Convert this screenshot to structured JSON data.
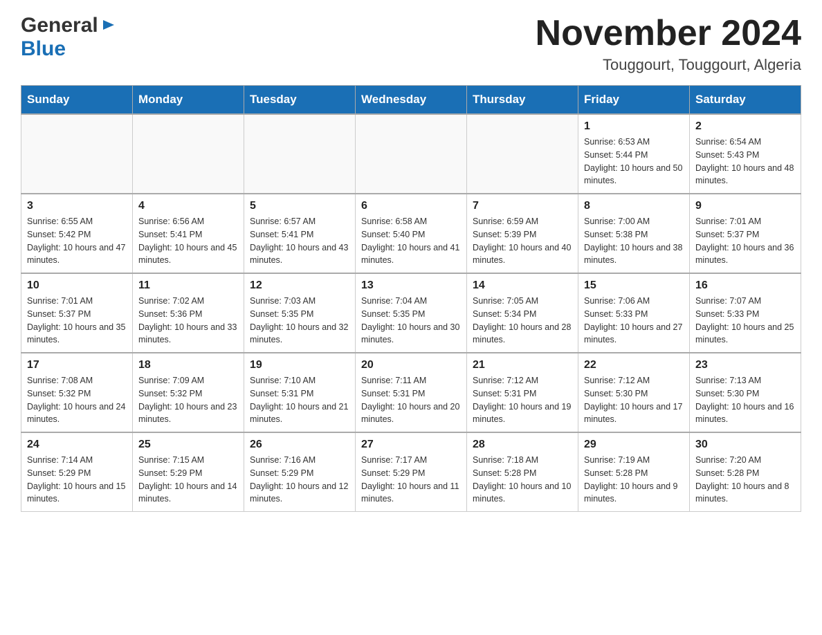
{
  "header": {
    "logo_general": "General",
    "logo_blue": "Blue",
    "month_title": "November 2024",
    "location": "Touggourt, Touggourt, Algeria"
  },
  "days_of_week": [
    "Sunday",
    "Monday",
    "Tuesday",
    "Wednesday",
    "Thursday",
    "Friday",
    "Saturday"
  ],
  "weeks": [
    [
      {
        "day": "",
        "sunrise": "",
        "sunset": "",
        "daylight": ""
      },
      {
        "day": "",
        "sunrise": "",
        "sunset": "",
        "daylight": ""
      },
      {
        "day": "",
        "sunrise": "",
        "sunset": "",
        "daylight": ""
      },
      {
        "day": "",
        "sunrise": "",
        "sunset": "",
        "daylight": ""
      },
      {
        "day": "",
        "sunrise": "",
        "sunset": "",
        "daylight": ""
      },
      {
        "day": "1",
        "sunrise": "Sunrise: 6:53 AM",
        "sunset": "Sunset: 5:44 PM",
        "daylight": "Daylight: 10 hours and 50 minutes."
      },
      {
        "day": "2",
        "sunrise": "Sunrise: 6:54 AM",
        "sunset": "Sunset: 5:43 PM",
        "daylight": "Daylight: 10 hours and 48 minutes."
      }
    ],
    [
      {
        "day": "3",
        "sunrise": "Sunrise: 6:55 AM",
        "sunset": "Sunset: 5:42 PM",
        "daylight": "Daylight: 10 hours and 47 minutes."
      },
      {
        "day": "4",
        "sunrise": "Sunrise: 6:56 AM",
        "sunset": "Sunset: 5:41 PM",
        "daylight": "Daylight: 10 hours and 45 minutes."
      },
      {
        "day": "5",
        "sunrise": "Sunrise: 6:57 AM",
        "sunset": "Sunset: 5:41 PM",
        "daylight": "Daylight: 10 hours and 43 minutes."
      },
      {
        "day": "6",
        "sunrise": "Sunrise: 6:58 AM",
        "sunset": "Sunset: 5:40 PM",
        "daylight": "Daylight: 10 hours and 41 minutes."
      },
      {
        "day": "7",
        "sunrise": "Sunrise: 6:59 AM",
        "sunset": "Sunset: 5:39 PM",
        "daylight": "Daylight: 10 hours and 40 minutes."
      },
      {
        "day": "8",
        "sunrise": "Sunrise: 7:00 AM",
        "sunset": "Sunset: 5:38 PM",
        "daylight": "Daylight: 10 hours and 38 minutes."
      },
      {
        "day": "9",
        "sunrise": "Sunrise: 7:01 AM",
        "sunset": "Sunset: 5:37 PM",
        "daylight": "Daylight: 10 hours and 36 minutes."
      }
    ],
    [
      {
        "day": "10",
        "sunrise": "Sunrise: 7:01 AM",
        "sunset": "Sunset: 5:37 PM",
        "daylight": "Daylight: 10 hours and 35 minutes."
      },
      {
        "day": "11",
        "sunrise": "Sunrise: 7:02 AM",
        "sunset": "Sunset: 5:36 PM",
        "daylight": "Daylight: 10 hours and 33 minutes."
      },
      {
        "day": "12",
        "sunrise": "Sunrise: 7:03 AM",
        "sunset": "Sunset: 5:35 PM",
        "daylight": "Daylight: 10 hours and 32 minutes."
      },
      {
        "day": "13",
        "sunrise": "Sunrise: 7:04 AM",
        "sunset": "Sunset: 5:35 PM",
        "daylight": "Daylight: 10 hours and 30 minutes."
      },
      {
        "day": "14",
        "sunrise": "Sunrise: 7:05 AM",
        "sunset": "Sunset: 5:34 PM",
        "daylight": "Daylight: 10 hours and 28 minutes."
      },
      {
        "day": "15",
        "sunrise": "Sunrise: 7:06 AM",
        "sunset": "Sunset: 5:33 PM",
        "daylight": "Daylight: 10 hours and 27 minutes."
      },
      {
        "day": "16",
        "sunrise": "Sunrise: 7:07 AM",
        "sunset": "Sunset: 5:33 PM",
        "daylight": "Daylight: 10 hours and 25 minutes."
      }
    ],
    [
      {
        "day": "17",
        "sunrise": "Sunrise: 7:08 AM",
        "sunset": "Sunset: 5:32 PM",
        "daylight": "Daylight: 10 hours and 24 minutes."
      },
      {
        "day": "18",
        "sunrise": "Sunrise: 7:09 AM",
        "sunset": "Sunset: 5:32 PM",
        "daylight": "Daylight: 10 hours and 23 minutes."
      },
      {
        "day": "19",
        "sunrise": "Sunrise: 7:10 AM",
        "sunset": "Sunset: 5:31 PM",
        "daylight": "Daylight: 10 hours and 21 minutes."
      },
      {
        "day": "20",
        "sunrise": "Sunrise: 7:11 AM",
        "sunset": "Sunset: 5:31 PM",
        "daylight": "Daylight: 10 hours and 20 minutes."
      },
      {
        "day": "21",
        "sunrise": "Sunrise: 7:12 AM",
        "sunset": "Sunset: 5:31 PM",
        "daylight": "Daylight: 10 hours and 19 minutes."
      },
      {
        "day": "22",
        "sunrise": "Sunrise: 7:12 AM",
        "sunset": "Sunset: 5:30 PM",
        "daylight": "Daylight: 10 hours and 17 minutes."
      },
      {
        "day": "23",
        "sunrise": "Sunrise: 7:13 AM",
        "sunset": "Sunset: 5:30 PM",
        "daylight": "Daylight: 10 hours and 16 minutes."
      }
    ],
    [
      {
        "day": "24",
        "sunrise": "Sunrise: 7:14 AM",
        "sunset": "Sunset: 5:29 PM",
        "daylight": "Daylight: 10 hours and 15 minutes."
      },
      {
        "day": "25",
        "sunrise": "Sunrise: 7:15 AM",
        "sunset": "Sunset: 5:29 PM",
        "daylight": "Daylight: 10 hours and 14 minutes."
      },
      {
        "day": "26",
        "sunrise": "Sunrise: 7:16 AM",
        "sunset": "Sunset: 5:29 PM",
        "daylight": "Daylight: 10 hours and 12 minutes."
      },
      {
        "day": "27",
        "sunrise": "Sunrise: 7:17 AM",
        "sunset": "Sunset: 5:29 PM",
        "daylight": "Daylight: 10 hours and 11 minutes."
      },
      {
        "day": "28",
        "sunrise": "Sunrise: 7:18 AM",
        "sunset": "Sunset: 5:28 PM",
        "daylight": "Daylight: 10 hours and 10 minutes."
      },
      {
        "day": "29",
        "sunrise": "Sunrise: 7:19 AM",
        "sunset": "Sunset: 5:28 PM",
        "daylight": "Daylight: 10 hours and 9 minutes."
      },
      {
        "day": "30",
        "sunrise": "Sunrise: 7:20 AM",
        "sunset": "Sunset: 5:28 PM",
        "daylight": "Daylight: 10 hours and 8 minutes."
      }
    ]
  ]
}
